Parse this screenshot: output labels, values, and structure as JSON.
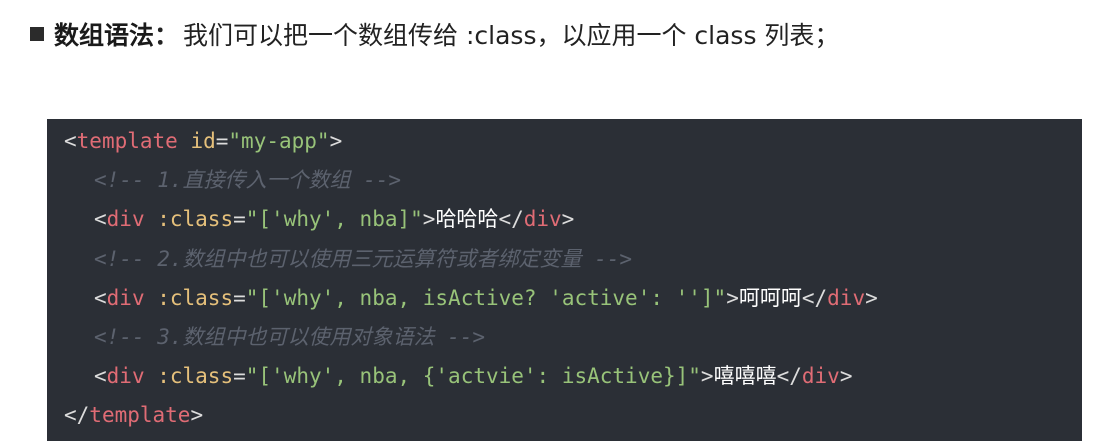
{
  "heading": {
    "term": "数组语法",
    "colon": "：",
    "description": "我们可以把一个数组传给 :class，以应用一个 class 列表；"
  },
  "code": {
    "line1": {
      "open": "<",
      "tag": "template",
      "attr": " id",
      "eq": "=",
      "value": "\"my-app\"",
      "close": ">"
    },
    "line2": {
      "comment": "<!-- 1.直接传入一个数组 -->"
    },
    "line3": {
      "open": "<",
      "tag": "div",
      "attr": " :class",
      "eq": "=",
      "value": "\"['why', nba]\"",
      "gt": ">",
      "text": "哈哈哈",
      "close_open": "</",
      "close_tag": "div",
      "close_gt": ">"
    },
    "line4": {
      "comment": "<!-- 2.数组中也可以使用三元运算符或者绑定变量 -->"
    },
    "line5": {
      "open": "<",
      "tag": "div",
      "attr": " :class",
      "eq": "=",
      "value": "\"['why', nba, isActive? 'active': '']\"",
      "gt": ">",
      "text": "呵呵呵",
      "close_open": "</",
      "close_tag": "div",
      "close_gt": ">"
    },
    "line6": {
      "comment": "<!-- 3.数组中也可以使用对象语法 -->"
    },
    "line7": {
      "open": "<",
      "tag": "div",
      "attr": " :class",
      "eq": "=",
      "value": "\"['why', nba, {'actvie': isActive}]\"",
      "gt": ">",
      "text": "嘻嘻嘻",
      "close_open": "</",
      "close_tag": "div",
      "close_gt": ">"
    },
    "line8": {
      "open": "</",
      "tag": "template",
      "close": ">"
    }
  }
}
